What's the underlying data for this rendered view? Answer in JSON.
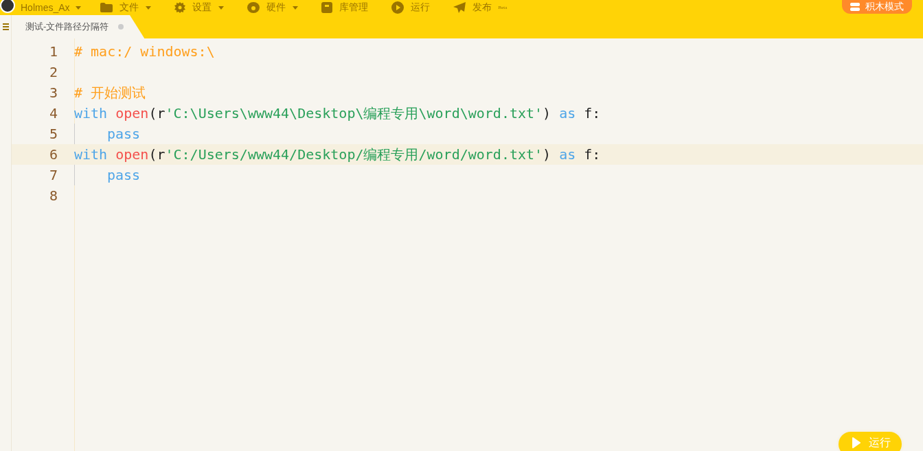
{
  "menu_bar": {
    "user": "Holmes_Ax",
    "items": [
      {
        "label": "文件",
        "dropdown": true
      },
      {
        "label": "设置",
        "dropdown": true
      },
      {
        "label": "硬件",
        "dropdown": true
      },
      {
        "label": "库管理",
        "dropdown": false
      },
      {
        "label": "运行",
        "dropdown": false
      },
      {
        "label": "发布",
        "dropdown": false,
        "badge": "Beta"
      }
    ],
    "mode_button": "积木模式"
  },
  "tabs": [
    {
      "label": "测试-文件路径分隔符",
      "selected": true
    }
  ],
  "editor": {
    "lines": [
      {
        "number": "1",
        "active": false,
        "indented": false,
        "tokens": [
          {
            "kind": "comment",
            "text": "# mac:/ windows:\\"
          }
        ]
      },
      {
        "number": "2",
        "active": false,
        "indented": false
      },
      {
        "number": "3",
        "active": false,
        "indented": false,
        "tokens": [
          {
            "kind": "comment",
            "text": "# 开始测试"
          }
        ]
      },
      {
        "number": "4",
        "active": false,
        "indented": false,
        "tokens": [
          {
            "kind": "keyword",
            "text": "with"
          },
          {
            "kind": "builtin",
            "text": " open"
          },
          {
            "kind": "plain",
            "text": "(r"
          },
          {
            "kind": "string",
            "text": "'C:\\Users\\www44\\Desktop\\编程专用\\word\\word.txt'"
          },
          {
            "kind": "plain",
            "text": ") "
          },
          {
            "kind": "keyword",
            "text": "as"
          },
          {
            "kind": "plain",
            "text": " f:"
          }
        ]
      },
      {
        "number": "5",
        "active": false,
        "indented": true,
        "tokens": [
          {
            "kind": "keyword",
            "text": "pass"
          }
        ]
      },
      {
        "number": "6",
        "active": true,
        "indented": false,
        "tokens": [
          {
            "kind": "keyword",
            "text": "with"
          },
          {
            "kind": "builtin",
            "text": " open"
          },
          {
            "kind": "plain",
            "text": "(r"
          },
          {
            "kind": "string",
            "text": "'C:/Users/www44/Desktop/编程专用/word/word.txt'"
          },
          {
            "kind": "plain",
            "text": ") "
          },
          {
            "kind": "keyword",
            "text": "as"
          },
          {
            "kind": "plain",
            "text": " f:"
          }
        ]
      },
      {
        "number": "7",
        "active": false,
        "indented": true,
        "tokens": [
          {
            "kind": "keyword",
            "text": "pass"
          }
        ]
      },
      {
        "number": "8",
        "active": false,
        "indented": false
      }
    ]
  },
  "run_button": "运行"
}
